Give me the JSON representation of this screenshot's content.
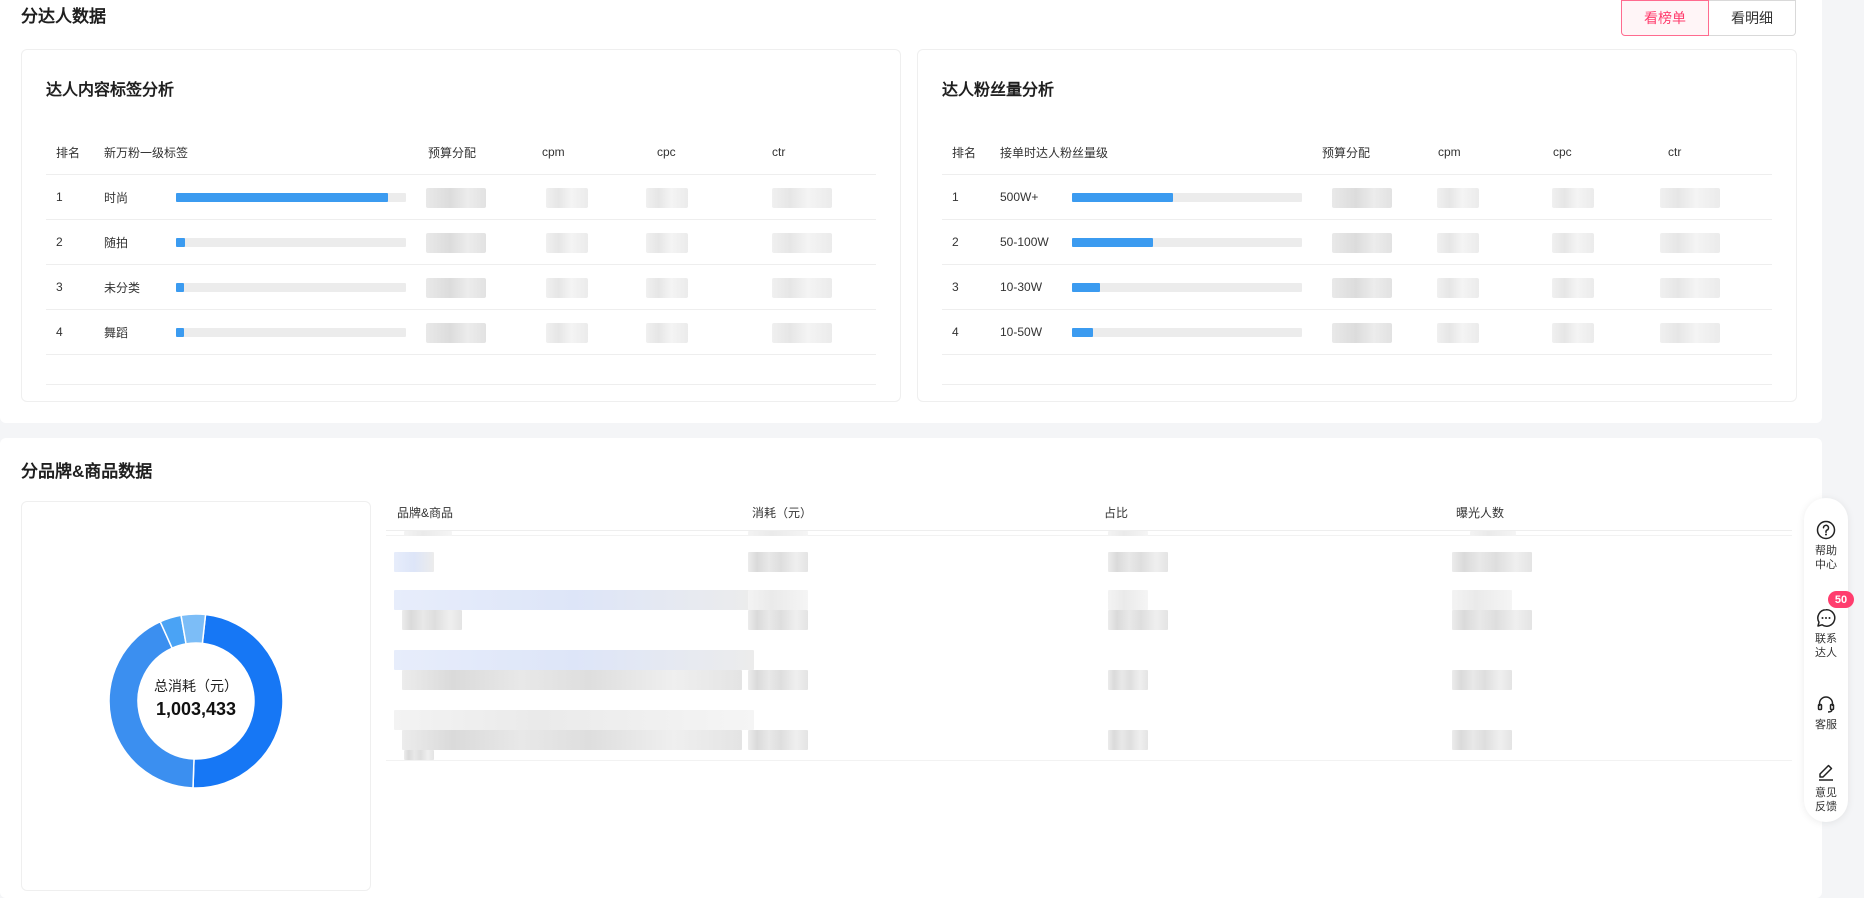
{
  "section1": {
    "title": "分达人数据",
    "toggle": [
      "看榜单",
      "看明细"
    ]
  },
  "content_card": {
    "title": "达人内容标签分析",
    "headers": [
      "排名",
      "新万粉一级标签",
      "预算分配",
      "cpm",
      "cpc",
      "ctr"
    ],
    "rows": [
      {
        "rank": "1",
        "label": "时尚",
        "progress": 0.92
      },
      {
        "rank": "2",
        "label": "随拍",
        "progress": 0.04
      },
      {
        "rank": "3",
        "label": "未分类",
        "progress": 0.03
      },
      {
        "rank": "4",
        "label": "舞蹈",
        "progress": 0.02
      }
    ]
  },
  "fans_card": {
    "title": "达人粉丝量分析",
    "headers": [
      "排名",
      "接单时达人粉丝量级",
      "预算分配",
      "cpm",
      "cpc",
      "ctr"
    ],
    "rows": [
      {
        "rank": "1",
        "label": "500W+",
        "progress": 0.44
      },
      {
        "rank": "2",
        "label": "50-100W",
        "progress": 0.35
      },
      {
        "rank": "3",
        "label": "10-30W",
        "progress": 0.12
      },
      {
        "rank": "4",
        "label": "10-50W",
        "progress": 0.09
      }
    ]
  },
  "section2": {
    "title": "分品牌&商品数据",
    "headers": [
      "品牌&商品",
      "消耗（元）",
      "占比",
      "曝光人数"
    ]
  },
  "donut": {
    "label": "总消耗（元）",
    "value": "1,003,433",
    "segments": [
      {
        "fraction": 0.488,
        "color": "#1677f5"
      },
      {
        "fraction": 0.427,
        "color": "#3b8ff0"
      },
      {
        "fraction": 0.04,
        "color": "#4aa3f5"
      },
      {
        "fraction": 0.045,
        "color": "#7cbdf7"
      }
    ]
  },
  "floatbar": {
    "help": "帮助中心",
    "contact": "联系达人",
    "contact_badge": "50",
    "service": "客服",
    "feedback": "意见反馈"
  }
}
